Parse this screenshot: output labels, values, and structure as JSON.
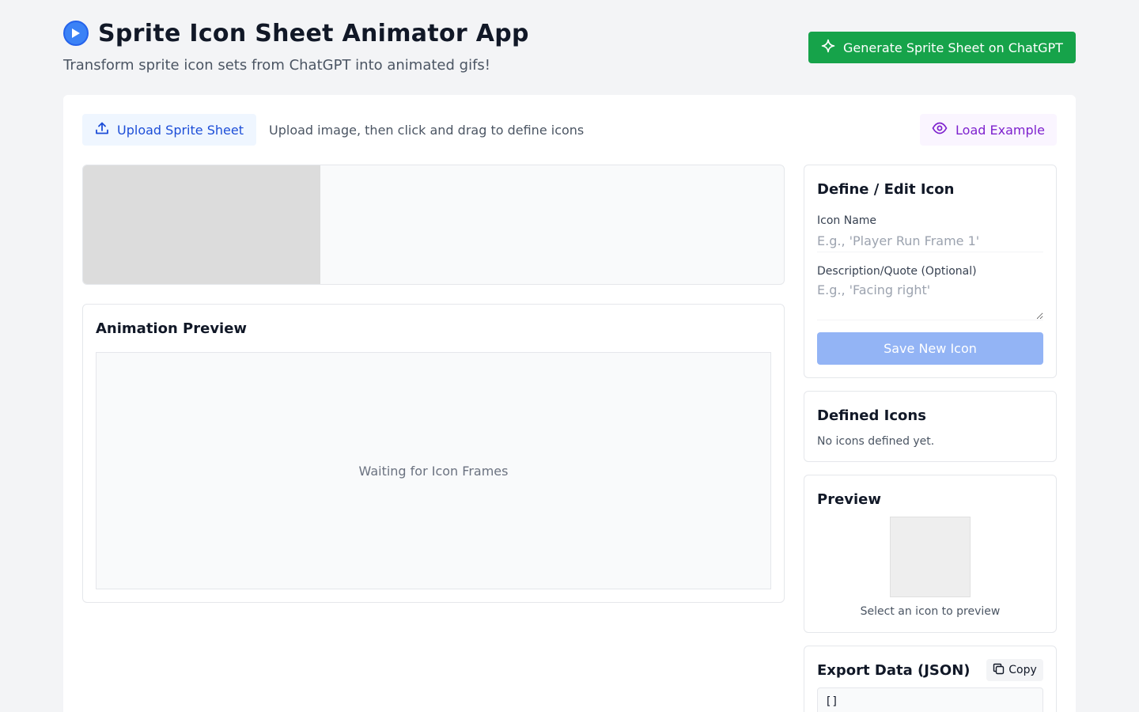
{
  "header": {
    "title": "Sprite Icon Sheet Animator App",
    "subtitle": "Transform sprite icon sets from ChatGPT into animated gifs!",
    "generate_button": "Generate Sprite Sheet on ChatGPT"
  },
  "toolbar": {
    "upload_button": "Upload Sprite Sheet",
    "upload_hint": "Upload image, then click and drag to define icons",
    "load_example_button": "Load Example"
  },
  "animation_preview": {
    "title": "Animation Preview",
    "waiting_text": "Waiting for Icon Frames"
  },
  "define_icon": {
    "title": "Define / Edit Icon",
    "name_label": "Icon Name",
    "name_placeholder": "E.g., 'Player Run Frame 1'",
    "name_value": "",
    "description_label": "Description/Quote (Optional)",
    "description_placeholder": "E.g., 'Facing right'",
    "description_value": "",
    "save_button": "Save New Icon"
  },
  "defined_icons": {
    "title": "Defined Icons",
    "empty_text": "No icons defined yet."
  },
  "preview": {
    "title": "Preview",
    "empty_text": "Select an icon to preview"
  },
  "export": {
    "title": "Export Data (JSON)",
    "copy_button": "Copy",
    "json_value": "[]"
  },
  "colors": {
    "accent_blue": "#3b82f6",
    "generate_green": "#16a34a",
    "upload_blue": "#1d4ed8",
    "load_purple": "#7e22ce",
    "save_disabled": "#93b4f5"
  },
  "icons": {
    "title_icon": "play-circle-icon",
    "generate_icon": "sparkle-icon",
    "upload_icon": "upload-icon",
    "load_icon": "eye-icon",
    "copy_icon": "copy-icon"
  }
}
